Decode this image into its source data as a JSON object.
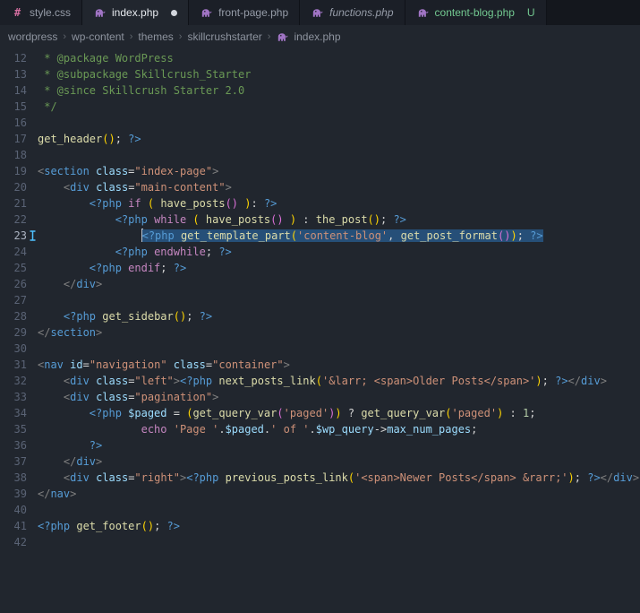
{
  "colors": {
    "editor_bg": "#21262e",
    "tabbar_bg": "#14171d",
    "tab_inactive_bg": "#1b1f27",
    "tab_active_bg": "#21262e",
    "selection_bg": "#264f78",
    "untracked_green": "#73C991",
    "php_icon_purple": "#A074C4",
    "css_icon_pink": "#d16d9e",
    "gutter_marker_blue": "#4fc1ff"
  },
  "tabs": [
    {
      "label": "style.css",
      "icon": "hash-icon",
      "active": false,
      "dirty": false,
      "badge": "",
      "italic": false,
      "git": ""
    },
    {
      "label": "index.php",
      "icon": "php-icon",
      "active": true,
      "dirty": true,
      "badge": "",
      "italic": false,
      "git": ""
    },
    {
      "label": "front-page.php",
      "icon": "php-icon",
      "active": false,
      "dirty": false,
      "badge": "",
      "italic": false,
      "git": ""
    },
    {
      "label": "functions.php",
      "icon": "php-icon",
      "active": false,
      "dirty": false,
      "badge": "",
      "italic": true,
      "git": ""
    },
    {
      "label": "content-blog.php",
      "icon": "php-icon",
      "active": false,
      "dirty": false,
      "badge": "U",
      "italic": false,
      "git": "untracked"
    }
  ],
  "breadcrumb": {
    "items": [
      {
        "label": "wordpress",
        "icon": ""
      },
      {
        "label": "wp-content",
        "icon": ""
      },
      {
        "label": "themes",
        "icon": ""
      },
      {
        "label": "skillcrushstarter",
        "icon": ""
      },
      {
        "label": "index.php",
        "icon": "php-icon"
      }
    ],
    "separator": "›"
  },
  "editor": {
    "selected_line": 23,
    "token_colors": {
      "cm": "#6a9955",
      "pt": "#808080",
      "tg": "#569cd6",
      "at": "#9cdcfe",
      "st": "#ce9178",
      "kw": "#c586c0",
      "fn": "#dcdcaa",
      "pl": "#d4d4d4",
      "nm": "#b5cea8",
      "b1": "#ffd602",
      "b2": "#da70d6"
    },
    "lines": [
      {
        "n": 12,
        "t": [
          [
            "cm",
            " * @package WordPress"
          ]
        ]
      },
      {
        "n": 13,
        "t": [
          [
            "cm",
            " * @subpackage Skillcrush_Starter"
          ]
        ]
      },
      {
        "n": 14,
        "t": [
          [
            "cm",
            " * @since Skillcrush Starter 2.0"
          ]
        ]
      },
      {
        "n": 15,
        "t": [
          [
            "cm",
            " */"
          ]
        ]
      },
      {
        "n": 16,
        "t": []
      },
      {
        "n": 17,
        "t": [
          [
            "fn",
            "get_header"
          ],
          [
            "b1",
            "()"
          ],
          [
            "pl",
            "; "
          ],
          [
            "tg",
            "?>"
          ]
        ]
      },
      {
        "n": 18,
        "t": []
      },
      {
        "n": 19,
        "t": [
          [
            "pt",
            "<"
          ],
          [
            "tg",
            "section"
          ],
          [
            "pl",
            " "
          ],
          [
            "at",
            "class"
          ],
          [
            "pl",
            "="
          ],
          [
            "st",
            "\"index-page\""
          ],
          [
            "pt",
            ">"
          ]
        ]
      },
      {
        "n": 20,
        "t": [
          [
            "pl",
            "    "
          ],
          [
            "pt",
            "<"
          ],
          [
            "tg",
            "div"
          ],
          [
            "pl",
            " "
          ],
          [
            "at",
            "class"
          ],
          [
            "pl",
            "="
          ],
          [
            "st",
            "\"main-content\""
          ],
          [
            "pt",
            ">"
          ]
        ]
      },
      {
        "n": 21,
        "t": [
          [
            "pl",
            "        "
          ],
          [
            "tg",
            "<?php"
          ],
          [
            "pl",
            " "
          ],
          [
            "kw",
            "if"
          ],
          [
            "pl",
            " "
          ],
          [
            "b1",
            "("
          ],
          [
            "pl",
            " "
          ],
          [
            "fn",
            "have_posts"
          ],
          [
            "b2",
            "()"
          ],
          [
            "pl",
            " "
          ],
          [
            "b1",
            ")"
          ],
          [
            "pl",
            ": "
          ],
          [
            "tg",
            "?>"
          ]
        ]
      },
      {
        "n": 22,
        "t": [
          [
            "pl",
            "            "
          ],
          [
            "tg",
            "<?php"
          ],
          [
            "pl",
            " "
          ],
          [
            "kw",
            "while"
          ],
          [
            "pl",
            " "
          ],
          [
            "b1",
            "("
          ],
          [
            "pl",
            " "
          ],
          [
            "fn",
            "have_posts"
          ],
          [
            "b2",
            "()"
          ],
          [
            "pl",
            " "
          ],
          [
            "b1",
            ")"
          ],
          [
            "pl",
            " : "
          ],
          [
            "fn",
            "the_post"
          ],
          [
            "b1",
            "()"
          ],
          [
            "pl",
            "; "
          ],
          [
            "tg",
            "?>"
          ]
        ]
      },
      {
        "n": 23,
        "sel": true,
        "indent": "                ",
        "t": [
          [
            "tg",
            "<?php"
          ],
          [
            "pl",
            " "
          ],
          [
            "fn",
            "get_template_part"
          ],
          [
            "b1",
            "("
          ],
          [
            "st",
            "'content-blog'"
          ],
          [
            "pl",
            ", "
          ],
          [
            "fn",
            "get_post_format"
          ],
          [
            "b2",
            "()"
          ],
          [
            "b1",
            ")"
          ],
          [
            "pl",
            "; "
          ],
          [
            "tg",
            "?>"
          ]
        ]
      },
      {
        "n": 24,
        "t": [
          [
            "pl",
            "            "
          ],
          [
            "tg",
            "<?php"
          ],
          [
            "pl",
            " "
          ],
          [
            "kw",
            "endwhile"
          ],
          [
            "pl",
            "; "
          ],
          [
            "tg",
            "?>"
          ]
        ]
      },
      {
        "n": 25,
        "t": [
          [
            "pl",
            "        "
          ],
          [
            "tg",
            "<?php"
          ],
          [
            "pl",
            " "
          ],
          [
            "kw",
            "endif"
          ],
          [
            "pl",
            "; "
          ],
          [
            "tg",
            "?>"
          ]
        ]
      },
      {
        "n": 26,
        "t": [
          [
            "pl",
            "    "
          ],
          [
            "pt",
            "</"
          ],
          [
            "tg",
            "div"
          ],
          [
            "pt",
            ">"
          ]
        ]
      },
      {
        "n": 27,
        "t": []
      },
      {
        "n": 28,
        "t": [
          [
            "pl",
            "    "
          ],
          [
            "tg",
            "<?php"
          ],
          [
            "pl",
            " "
          ],
          [
            "fn",
            "get_sidebar"
          ],
          [
            "b1",
            "()"
          ],
          [
            "pl",
            "; "
          ],
          [
            "tg",
            "?>"
          ]
        ]
      },
      {
        "n": 29,
        "t": [
          [
            "pt",
            "</"
          ],
          [
            "tg",
            "section"
          ],
          [
            "pt",
            ">"
          ]
        ]
      },
      {
        "n": 30,
        "t": []
      },
      {
        "n": 31,
        "t": [
          [
            "pt",
            "<"
          ],
          [
            "tg",
            "nav"
          ],
          [
            "pl",
            " "
          ],
          [
            "at",
            "id"
          ],
          [
            "pl",
            "="
          ],
          [
            "st",
            "\"navigation\""
          ],
          [
            "pl",
            " "
          ],
          [
            "at",
            "class"
          ],
          [
            "pl",
            "="
          ],
          [
            "st",
            "\"container\""
          ],
          [
            "pt",
            ">"
          ]
        ]
      },
      {
        "n": 32,
        "t": [
          [
            "pl",
            "    "
          ],
          [
            "pt",
            "<"
          ],
          [
            "tg",
            "div"
          ],
          [
            "pl",
            " "
          ],
          [
            "at",
            "class"
          ],
          [
            "pl",
            "="
          ],
          [
            "st",
            "\"left\""
          ],
          [
            "pt",
            ">"
          ],
          [
            "tg",
            "<?php"
          ],
          [
            "pl",
            " "
          ],
          [
            "fn",
            "next_posts_link"
          ],
          [
            "b1",
            "("
          ],
          [
            "st",
            "'&larr; <span>Older Posts</span>'"
          ],
          [
            "b1",
            ")"
          ],
          [
            "pl",
            "; "
          ],
          [
            "tg",
            "?>"
          ],
          [
            "pt",
            "</"
          ],
          [
            "tg",
            "div"
          ],
          [
            "pt",
            ">"
          ]
        ]
      },
      {
        "n": 33,
        "t": [
          [
            "pl",
            "    "
          ],
          [
            "pt",
            "<"
          ],
          [
            "tg",
            "div"
          ],
          [
            "pl",
            " "
          ],
          [
            "at",
            "class"
          ],
          [
            "pl",
            "="
          ],
          [
            "st",
            "\"pagination\""
          ],
          [
            "pt",
            ">"
          ]
        ]
      },
      {
        "n": 34,
        "t": [
          [
            "pl",
            "        "
          ],
          [
            "tg",
            "<?php"
          ],
          [
            "pl",
            " "
          ],
          [
            "at",
            "$paged"
          ],
          [
            "pl",
            " = "
          ],
          [
            "b1",
            "("
          ],
          [
            "fn",
            "get_query_var"
          ],
          [
            "b2",
            "("
          ],
          [
            "st",
            "'paged'"
          ],
          [
            "b2",
            ")"
          ],
          [
            "b1",
            ")"
          ],
          [
            "pl",
            " ? "
          ],
          [
            "fn",
            "get_query_var"
          ],
          [
            "b1",
            "("
          ],
          [
            "st",
            "'paged'"
          ],
          [
            "b1",
            ")"
          ],
          [
            "pl",
            " : "
          ],
          [
            "nm",
            "1"
          ],
          [
            "pl",
            ";"
          ]
        ]
      },
      {
        "n": 35,
        "t": [
          [
            "pl",
            "                "
          ],
          [
            "kw",
            "echo"
          ],
          [
            "pl",
            " "
          ],
          [
            "st",
            "'Page '"
          ],
          [
            "pl",
            "."
          ],
          [
            "at",
            "$paged"
          ],
          [
            "pl",
            "."
          ],
          [
            "st",
            "' of '"
          ],
          [
            "pl",
            "."
          ],
          [
            "at",
            "$wp_query"
          ],
          [
            "pl",
            "->"
          ],
          [
            "at",
            "max_num_pages"
          ],
          [
            "pl",
            ";"
          ]
        ]
      },
      {
        "n": 36,
        "t": [
          [
            "pl",
            "        "
          ],
          [
            "tg",
            "?>"
          ]
        ]
      },
      {
        "n": 37,
        "t": [
          [
            "pl",
            "    "
          ],
          [
            "pt",
            "</"
          ],
          [
            "tg",
            "div"
          ],
          [
            "pt",
            ">"
          ]
        ]
      },
      {
        "n": 38,
        "t": [
          [
            "pl",
            "    "
          ],
          [
            "pt",
            "<"
          ],
          [
            "tg",
            "div"
          ],
          [
            "pl",
            " "
          ],
          [
            "at",
            "class"
          ],
          [
            "pl",
            "="
          ],
          [
            "st",
            "\"right\""
          ],
          [
            "pt",
            ">"
          ],
          [
            "tg",
            "<?php"
          ],
          [
            "pl",
            " "
          ],
          [
            "fn",
            "previous_posts_link"
          ],
          [
            "b1",
            "("
          ],
          [
            "st",
            "'<span>Newer Posts</span> &rarr;'"
          ],
          [
            "b1",
            ")"
          ],
          [
            "pl",
            "; "
          ],
          [
            "tg",
            "?>"
          ],
          [
            "pt",
            "</"
          ],
          [
            "tg",
            "div"
          ],
          [
            "pt",
            ">"
          ]
        ]
      },
      {
        "n": 39,
        "t": [
          [
            "pt",
            "</"
          ],
          [
            "tg",
            "nav"
          ],
          [
            "pt",
            ">"
          ]
        ]
      },
      {
        "n": 40,
        "t": []
      },
      {
        "n": 41,
        "t": [
          [
            "tg",
            "<?php"
          ],
          [
            "pl",
            " "
          ],
          [
            "fn",
            "get_footer"
          ],
          [
            "b1",
            "()"
          ],
          [
            "pl",
            "; "
          ],
          [
            "tg",
            "?>"
          ]
        ]
      },
      {
        "n": 42,
        "t": []
      }
    ]
  }
}
